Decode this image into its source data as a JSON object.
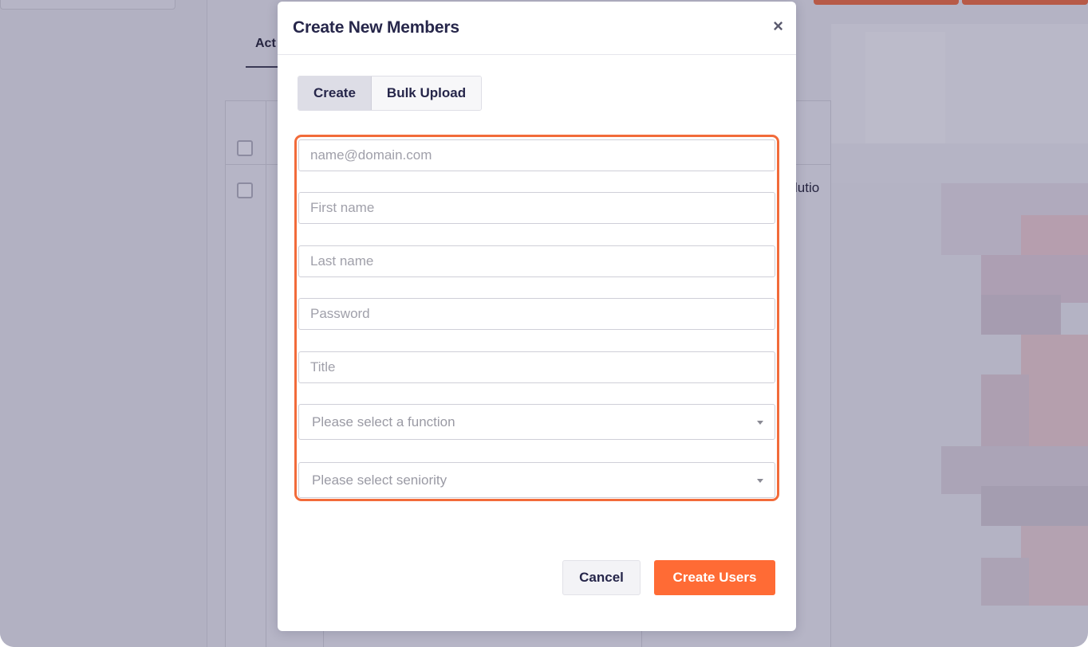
{
  "background": {
    "tab_label": "Act",
    "cell_text": "lutio"
  },
  "modal": {
    "title": "Create New Members",
    "close_glyph": "×",
    "tabs": [
      {
        "label": "Create",
        "active": true
      },
      {
        "label": "Bulk Upload",
        "active": false
      }
    ],
    "fields": {
      "email": {
        "placeholder": "name@domain.com",
        "value": ""
      },
      "first_name": {
        "placeholder": "First name",
        "value": ""
      },
      "last_name": {
        "placeholder": "Last name",
        "value": ""
      },
      "password": {
        "placeholder": "Password",
        "value": ""
      },
      "title": {
        "placeholder": "Title",
        "value": ""
      }
    },
    "selects": {
      "function": {
        "selected": "Please select a function"
      },
      "seniority": {
        "selected": "Please select seniority"
      }
    },
    "buttons": {
      "cancel": "Cancel",
      "create": "Create Users"
    }
  },
  "colors": {
    "accent": "#ff6b35",
    "highlight_border": "#f26b3a",
    "title_text": "#26264a",
    "overlay_bg": "#b4b3c4"
  },
  "icons": {
    "close": "close-icon",
    "select_caret": "chevron-down-icon",
    "checkbox": "checkbox-icon"
  }
}
